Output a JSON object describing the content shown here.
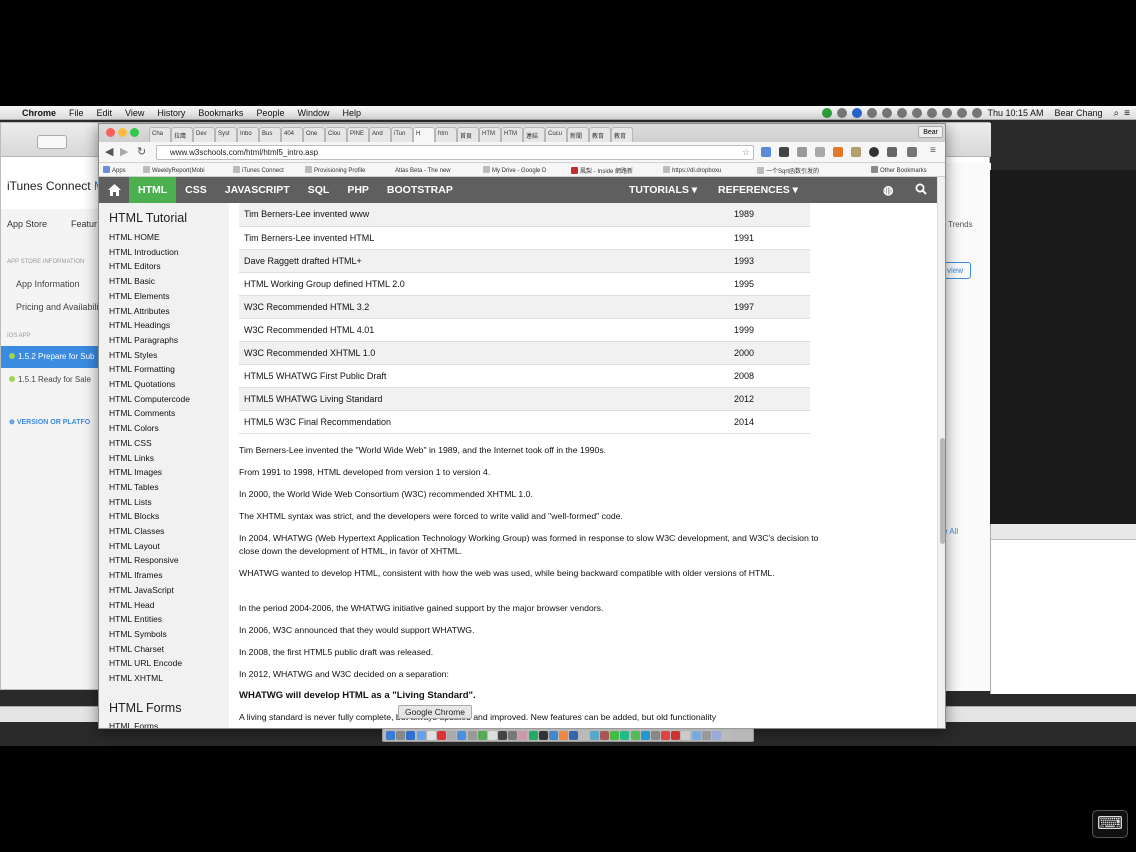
{
  "menubar": {
    "items": [
      "Chrome",
      "File",
      "Edit",
      "View",
      "History",
      "Bookmarks",
      "People",
      "Window",
      "Help"
    ],
    "clock": "Thu 10:15 AM",
    "user": "Bear Chang"
  },
  "itunes": {
    "title": "iTunes Connect",
    "title_suffix": "M",
    "tabs": [
      "App Store",
      "Featur"
    ],
    "section_info": "APP STORE INFORMATION",
    "items": [
      "App Information",
      "Pricing and Availabilit"
    ],
    "section_ios": "iOS APP",
    "versions": [
      "1.5.2 Prepare for Sub",
      "1.5.1 Ready for Sale"
    ],
    "add_version": "VERSION OR PLATFO",
    "trends": "Trends",
    "preview_btn": "view",
    "see_all": "e All",
    "help": "?"
  },
  "chrome": {
    "tabs": [
      "Cha",
      "拉鹰",
      "Dev",
      "Syst",
      "Inbo",
      "Bus",
      "404",
      "One",
      "Clou",
      "PINE",
      "And",
      "iTun",
      "H",
      "htm",
      "首頁",
      "HTM",
      "HTM",
      "連結",
      "Cucu",
      "新聞",
      "教育",
      "教育"
    ],
    "profile": "Bear",
    "url": "www.w3schools.com/html/html5_intro.asp",
    "bookmarks": [
      "Apps",
      "WeeklyReport(Mobi",
      "iTunes Connect",
      "Provisioning Profile",
      "Atlas Beta - The new",
      "My Drive - Google D",
      "鳳梨 - Inside 網路新",
      "https://dl.dropboxu",
      "一个Sqrt函数引发的",
      "Other Bookmarks"
    ]
  },
  "w3": {
    "nav": [
      "HTML",
      "CSS",
      "JAVASCRIPT",
      "SQL",
      "PHP",
      "BOOTSTRAP"
    ],
    "tutorials": "TUTORIALS ▾",
    "references": "REFERENCES ▾",
    "sidebar_heading": "HTML Tutorial",
    "sidebar_items": [
      "HTML HOME",
      "HTML Introduction",
      "HTML Editors",
      "HTML Basic",
      "HTML Elements",
      "HTML Attributes",
      "HTML Headings",
      "HTML Paragraphs",
      "HTML Styles",
      "HTML Formatting",
      "HTML Quotations",
      "HTML Computercode",
      "HTML Comments",
      "HTML Colors",
      "HTML CSS",
      "HTML Links",
      "HTML Images",
      "HTML Tables",
      "HTML Lists",
      "HTML Blocks",
      "HTML Classes",
      "HTML Layout",
      "HTML Responsive",
      "HTML Iframes",
      "HTML JavaScript",
      "HTML Head",
      "HTML Entities",
      "HTML Symbols",
      "HTML Charset",
      "HTML URL Encode",
      "HTML XHTML"
    ],
    "sidebar_heading2": "HTML Forms",
    "sidebar_next": "HTML Forms",
    "history": [
      {
        "event": "Tim Berners-Lee invented www",
        "year": "1989"
      },
      {
        "event": "Tim Berners-Lee invented HTML",
        "year": "1991"
      },
      {
        "event": "Dave Raggett drafted HTML+",
        "year": "1993"
      },
      {
        "event": "HTML Working Group defined HTML 2.0",
        "year": "1995"
      },
      {
        "event": "W3C Recommended HTML 3.2",
        "year": "1997"
      },
      {
        "event": "W3C Recommended HTML 4.01",
        "year": "1999"
      },
      {
        "event": "W3C Recommended XHTML 1.0",
        "year": "2000"
      },
      {
        "event": "HTML5 WHATWG First Public Draft",
        "year": "2008"
      },
      {
        "event": "HTML5 WHATWG Living Standard",
        "year": "2012"
      },
      {
        "event": "HTML5 W3C Final Recommendation",
        "year": "2014"
      }
    ],
    "paragraphs": [
      "Tim Berners-Lee invented the \"World Wide Web\" in 1989, and the Internet took off in the 1990s.",
      "From 1991 to 1998, HTML developed from version 1 to version 4.",
      "In 2000, the World Wide Web Consortium (W3C) recommended XHTML 1.0.",
      "The XHTML syntax was strict, and the developers were forced to write valid and \"well-formed\" code.",
      "In 2004, WHATWG (Web Hypertext Application Technology Working Group) was formed in response to slow W3C development, and W3C's decision to close down the development of HTML, in favor of XHTML.",
      "WHATWG wanted to develop HTML, consistent with how the web was used, while being backward compatible with older versions of HTML.",
      "In the period 2004-2006, the WHATWG initiative gained support by the major browser vendors.",
      "In 2006, W3C announced that they would support WHATWG.",
      "In 2008, the first HTML5 public draft was released.",
      "In 2012, WHATWG and W3C decided on a separation:"
    ],
    "bold_statement": "WHATWG will develop HTML as a \"Living Standard\".",
    "last_paragraph": "A living standard is never fully complete, but always updated and improved. New features can be added, but old functionality"
  },
  "dock": {
    "tooltip": "Google Chrome"
  },
  "colors": {
    "w3_green": "#4caf50",
    "w3_nav": "#5f5f5f",
    "itunes_blue": "#3b8be0"
  }
}
